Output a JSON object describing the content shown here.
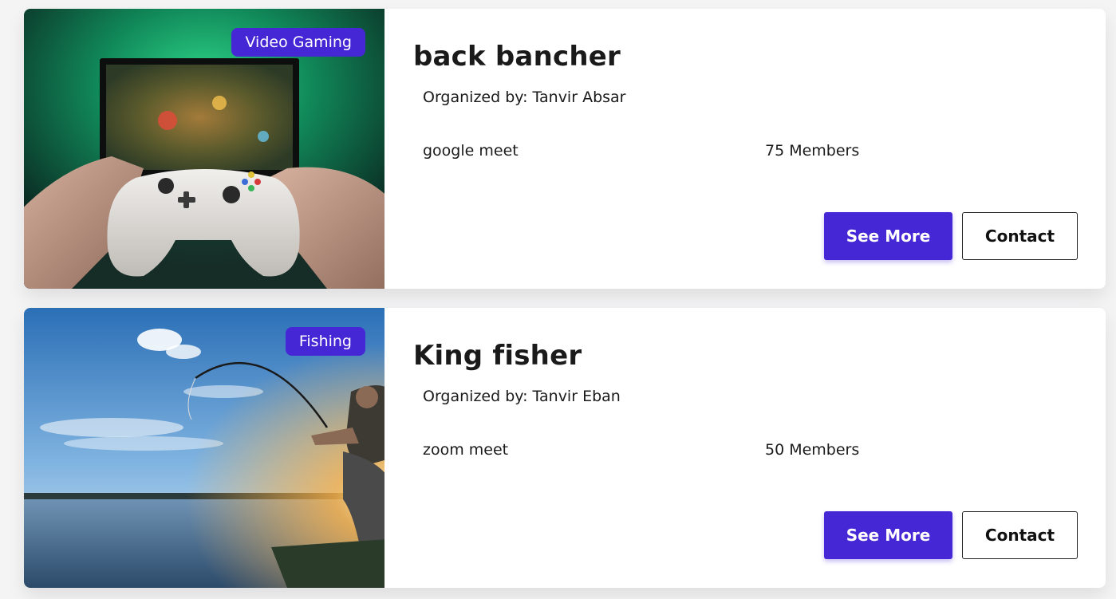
{
  "events": [
    {
      "category": "Video Gaming",
      "title": "back bancher",
      "organizer_label": "Organized by:",
      "organizer_name": "Tanvir Absar",
      "platform": "google meet",
      "member_count": "75",
      "member_label": "Members",
      "primary_label": "See More",
      "secondary_label": "Contact",
      "image_icon": "gaming-controller-photo"
    },
    {
      "category": "Fishing",
      "title": "King fisher",
      "organizer_label": "Organized by:",
      "organizer_name": "Tanvir Eban",
      "platform": "zoom meet",
      "member_count": "50",
      "member_label": "Members",
      "primary_label": "See More",
      "secondary_label": "Contact",
      "image_icon": "fishing-sunset-photo"
    }
  ],
  "colors": {
    "accent": "#4527d6",
    "card_background": "#ffffff",
    "page_background": "#f4f4f5"
  }
}
